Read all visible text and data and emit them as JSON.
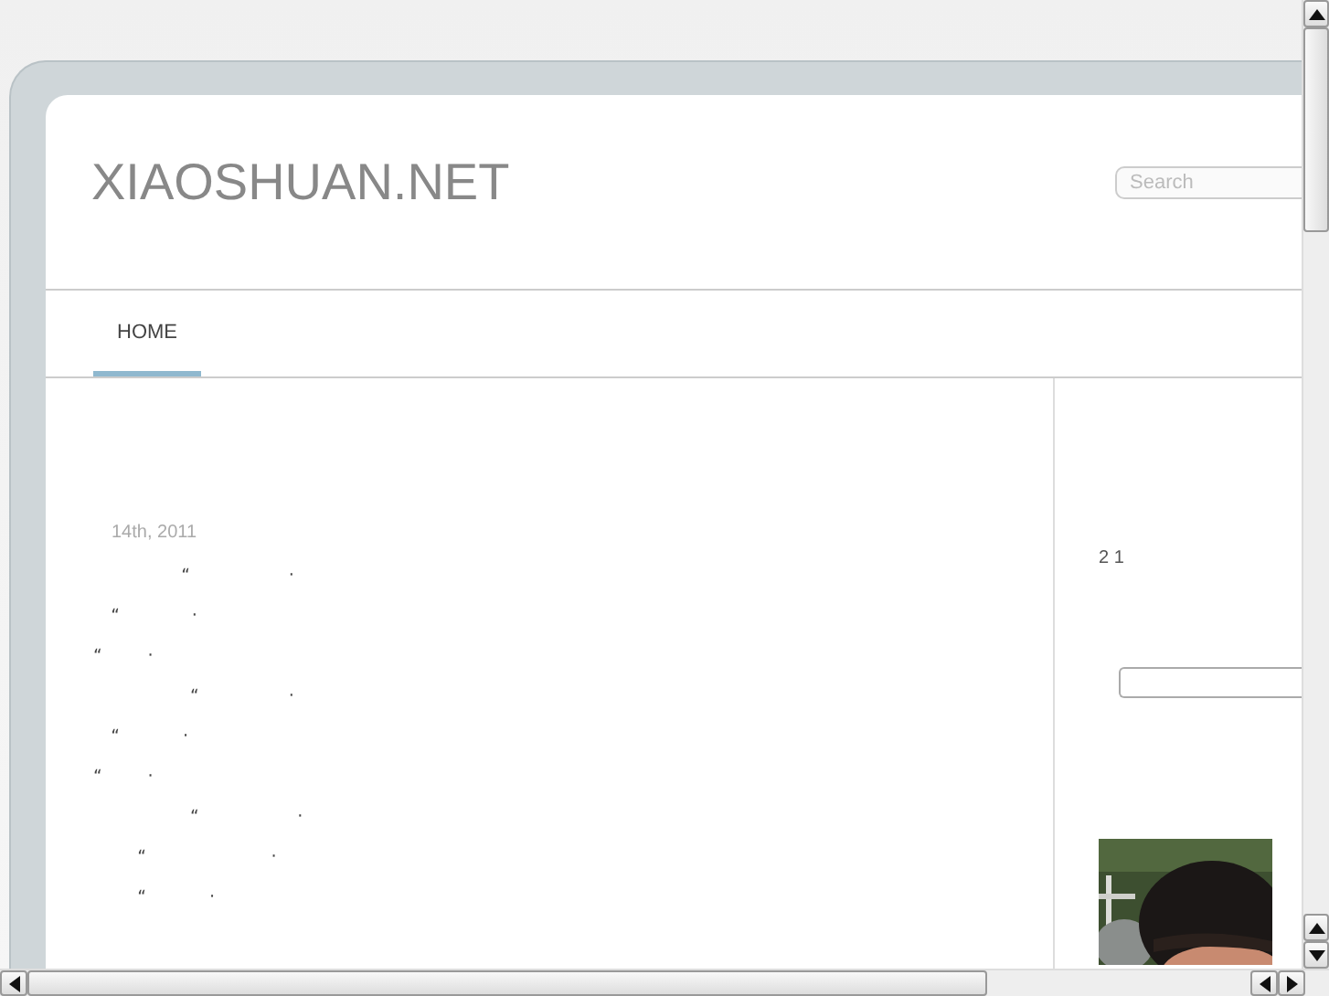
{
  "site": {
    "title": "XIAOSHUAN.NET"
  },
  "search": {
    "placeholder": "Search"
  },
  "nav": [
    {
      "label": "HOME",
      "selected": true
    }
  ],
  "post": {
    "date": "14th, 2011",
    "lines": [
      "          “           ·",
      "  “        ·",
      "“     ·",
      "           “          ·",
      "  “       ·",
      "“     ·",
      "           “           ·",
      "     “              ·",
      "     “       ·"
    ]
  },
  "sidebar": {
    "text": "2 1",
    "field": {
      "kind": "text-input"
    }
  }
}
